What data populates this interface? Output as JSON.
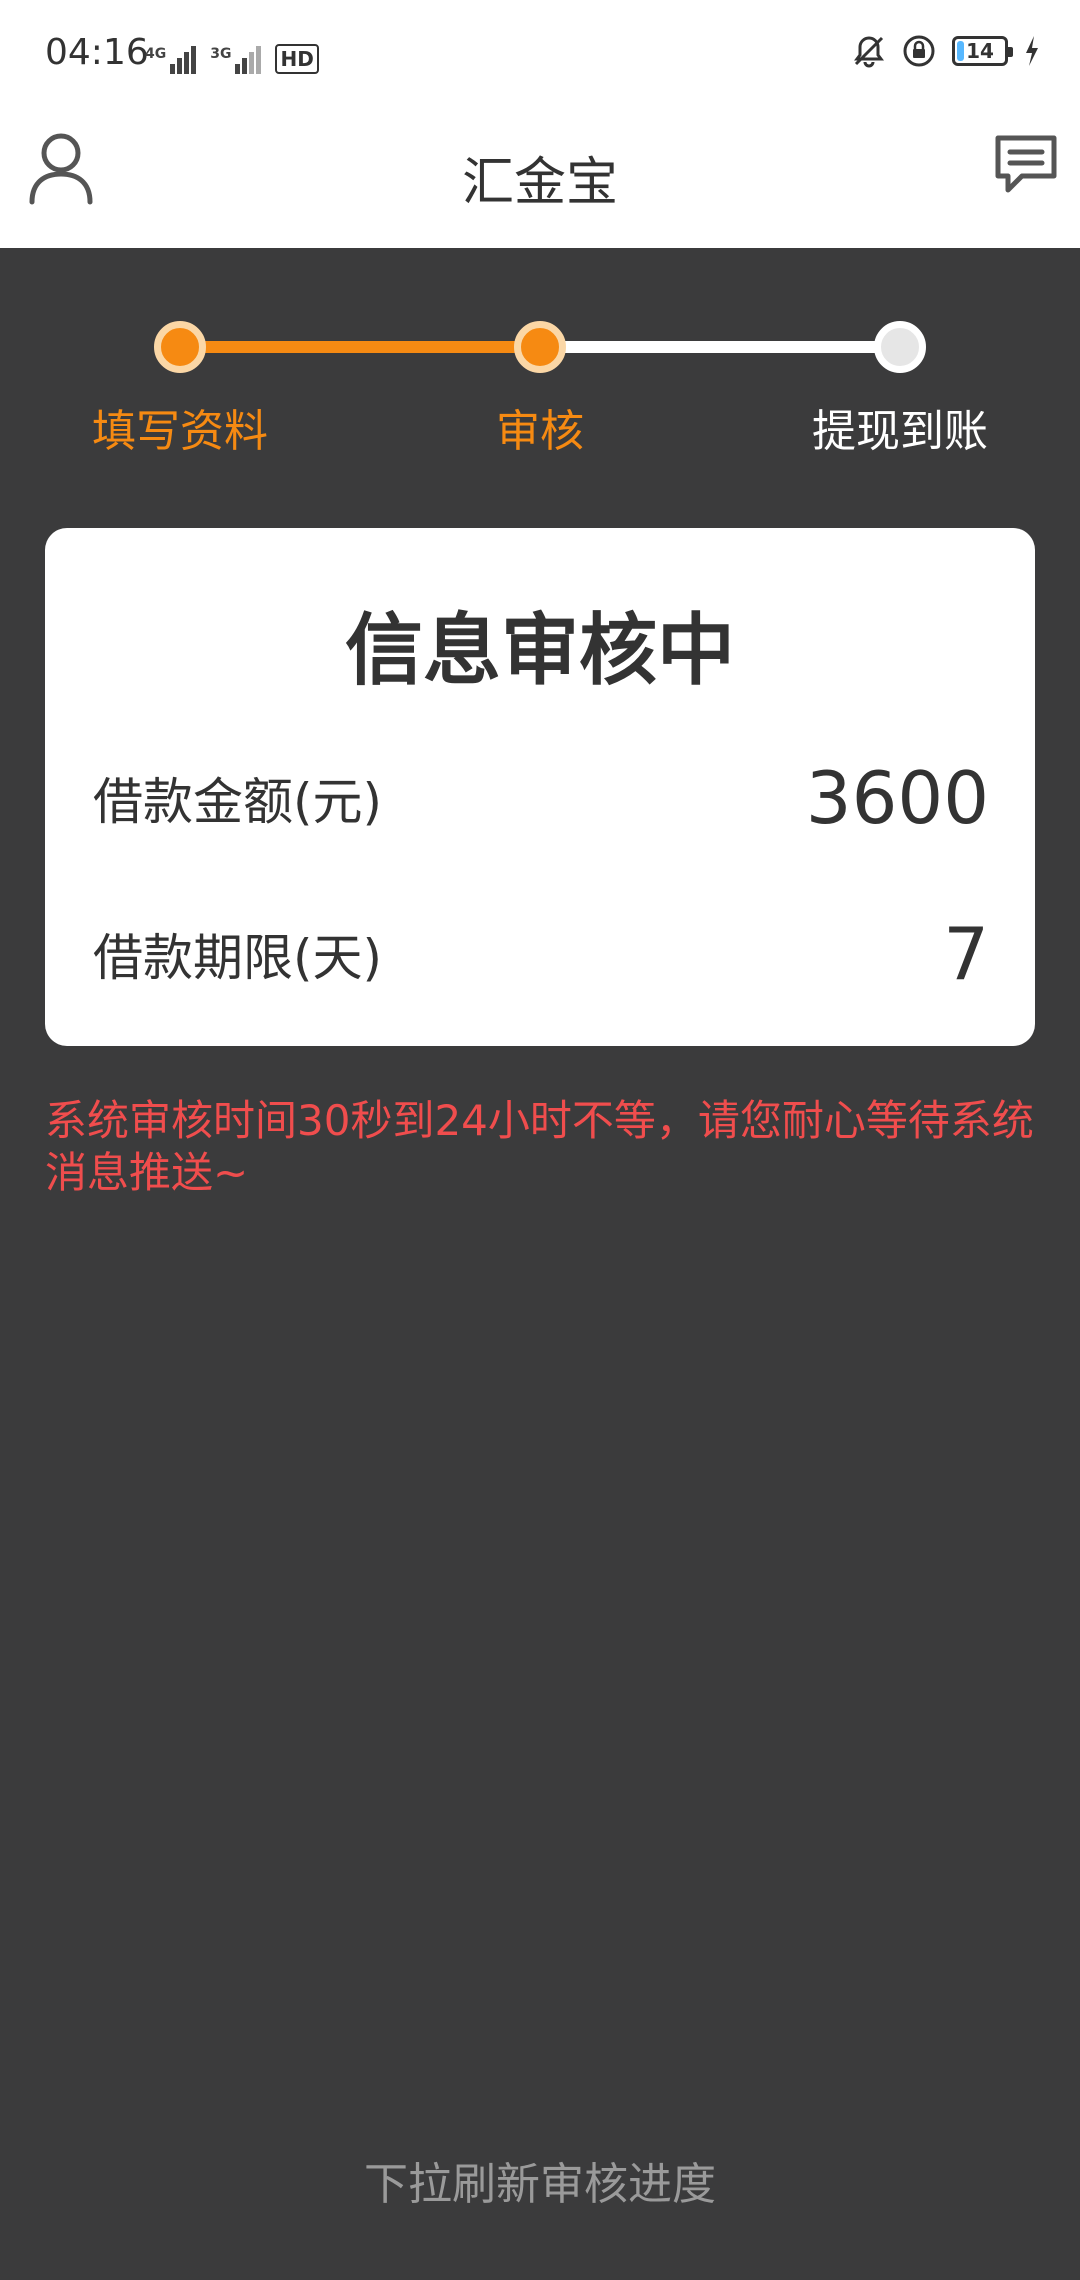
{
  "status_bar": {
    "time": "04:16",
    "net1": "4G",
    "net2": "3G",
    "hd": "HD",
    "battery": "14",
    "battery_level": 0.14
  },
  "header": {
    "title": "汇金宝"
  },
  "steps": [
    {
      "label": "填写资料",
      "state": "done"
    },
    {
      "label": "审核",
      "state": "current"
    },
    {
      "label": "提现到账",
      "state": "pending"
    }
  ],
  "card": {
    "title": "信息审核中",
    "rows": [
      {
        "label": "借款金额(元)",
        "value": "3600"
      },
      {
        "label": "借款期限(天)",
        "value": "7"
      }
    ]
  },
  "notice": "系统审核时间30秒到24小时不等，请您耐心等待系统消息推送~",
  "pull_hint": "下拉刷新审核进度",
  "colors": {
    "accent": "#f68a12",
    "accent_light": "#fbd7a6",
    "background": "#3b3b3c",
    "warning": "#f04d4d"
  }
}
